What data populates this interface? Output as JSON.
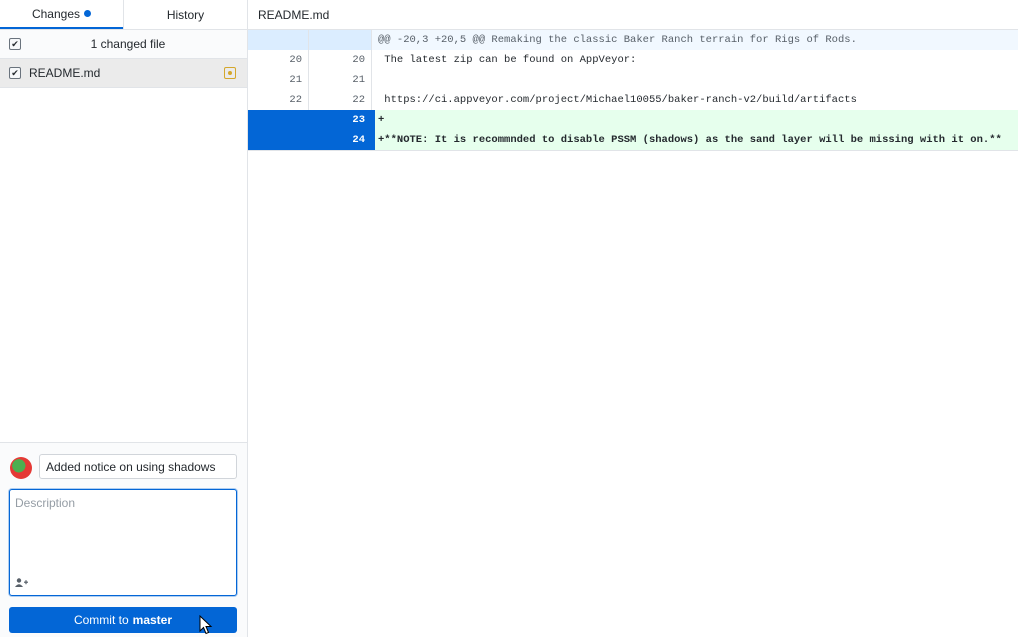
{
  "sidebar": {
    "tabs": [
      {
        "label": "Changes",
        "active": true
      },
      {
        "label": "History",
        "active": false
      }
    ],
    "changed_count_label": "1 changed file",
    "files": [
      {
        "name": "README.md",
        "status": "modified"
      }
    ]
  },
  "commit": {
    "summary_value": "Added notice on using shadows",
    "description_placeholder": "Description",
    "button_prefix": "Commit to",
    "branch": "master"
  },
  "diff": {
    "file_name": "README.md",
    "hunk_header": "@@ -20,3 +20,5 @@ Remaking the classic Baker Ranch terrain for Rigs of Rods.",
    "lines": [
      {
        "type": "ctx",
        "old": "20",
        "new": "20",
        "text": " The latest zip can be found on AppVeyor:"
      },
      {
        "type": "ctx",
        "old": "21",
        "new": "21",
        "text": ""
      },
      {
        "type": "ctx",
        "old": "22",
        "new": "22",
        "text": " https://ci.appveyor.com/project/Michael10055/baker-ranch-v2/build/artifacts"
      },
      {
        "type": "add",
        "old": "",
        "new": "23",
        "text": "+"
      },
      {
        "type": "add",
        "old": "",
        "new": "24",
        "text": "+**NOTE: It is recommnded to disable PSSM (shadows) as the sand layer will be missing with it on.**"
      }
    ]
  },
  "colors": {
    "accent": "#0366d6",
    "added_bg": "#e6ffed",
    "hunk_bg": "#f1f8ff",
    "modified": "#d4a72c"
  }
}
